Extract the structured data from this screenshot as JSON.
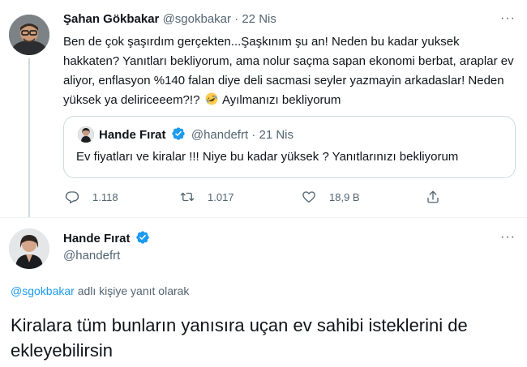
{
  "tweet": {
    "author_name": "Şahan Gökbakar",
    "author_handle": "@sgokbakar",
    "separator": "·",
    "date": "22 Nis",
    "text_before_emoji": "Ben de çok şaşırdım gerçekten...Şaşkınım şu an! Neden bu kadar yuksek hakkaten? Yanıtları bekliyorum, ama nolur saçma sapan ekonomi berbat, araplar ev aliyor, enflasyon %140 falan diye deli sacmasi seyler yazmayin arkadaslar! Neden yüksek ya deliriceeem?!?",
    "emoji": "rolling-on-floor-laughing-emoji",
    "text_after_emoji": "Ayılmanızı bekliyorum",
    "quoted": {
      "author_name": "Hande Fırat",
      "author_handle": "@handefrt",
      "separator": "·",
      "date": "21 Nis",
      "text": "Ev fiyatları ve kiralar !!! Niye bu kadar yüksek ? Yanıtlarınızı bekliyorum"
    },
    "actions": {
      "replies": "1.118",
      "retweets": "1.017",
      "likes": "18,9 B"
    }
  },
  "reply": {
    "author_name": "Hande Fırat",
    "author_handle": "@handefrt",
    "replying_to_mention": "@sgokbakar",
    "replying_to_suffix": " adlı kişiye yanıt olarak",
    "text": "Kiralara tüm bunların yanısıra uçan ev sahibi isteklerini de ekleyebilirsin"
  },
  "more_label": "···",
  "colors": {
    "verified": "#1d9bf0",
    "secondary_text": "#536471",
    "primary_text": "#0f1419",
    "border": "#cfd9de"
  }
}
